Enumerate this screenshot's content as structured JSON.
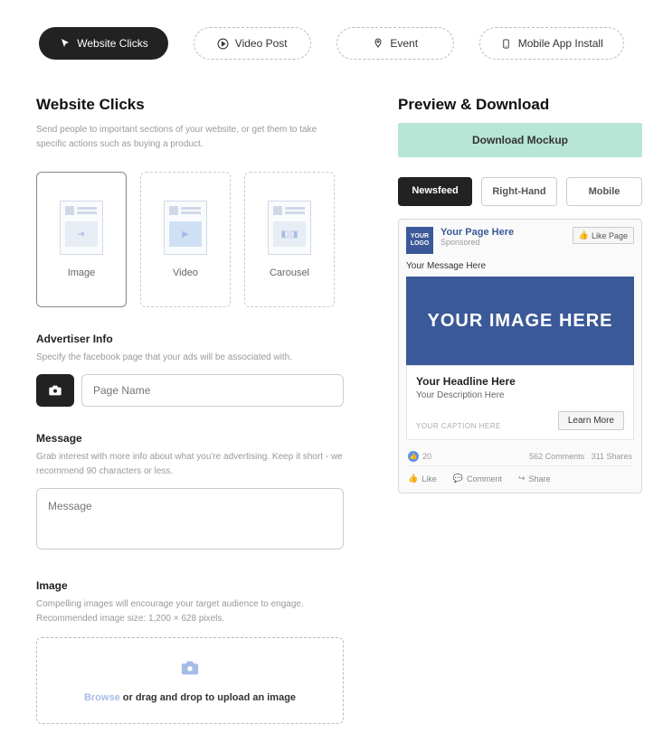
{
  "topTabs": {
    "websiteClicks": "Website Clicks",
    "videoPost": "Video Post",
    "event": "Event",
    "mobileApp": "Mobile App Install"
  },
  "left": {
    "title": "Website Clicks",
    "subtitle": "Send people to important sections of your website, or get them to take specific actions such as buying a product.",
    "media": {
      "image": "Image",
      "video": "Video",
      "carousel": "Carousel"
    },
    "advertiser": {
      "title": "Advertiser Info",
      "sub": "Specify the facebook page that your ads will be associated with.",
      "placeholder": "Page Name"
    },
    "message": {
      "title": "Message",
      "sub": "Grab interest with more info about what you're advertising. Keep it short - we recommend 90 characters or less.",
      "placeholder": "Message"
    },
    "image": {
      "title": "Image",
      "sub": "Compelling images will encourage your target audience to engage. Recommended image size: 1,200 × 628 pixels.",
      "browse": "Browse",
      "rest": " or drag and drop to upload an image"
    }
  },
  "right": {
    "title": "Preview & Download",
    "download": "Download Mockup",
    "tabs": {
      "newsfeed": "Newsfeed",
      "righthand": "Right-Hand",
      "mobile": "Mobile"
    },
    "preview": {
      "logo": "YOUR LOGO",
      "page": "Your Page Here",
      "sponsored": "Sponsored",
      "likePage": "Like Page",
      "message": "Your Message Here",
      "hero": "YOUR IMAGE HERE",
      "headline": "Your Headline Here",
      "desc": "Your Description Here",
      "caption": "YOUR CAPTION HERE",
      "learn": "Learn More",
      "likes": "20",
      "comments": "562 Comments",
      "shares": "311 Shares",
      "actLike": "Like",
      "actComment": "Comment",
      "actShare": "Share"
    }
  }
}
